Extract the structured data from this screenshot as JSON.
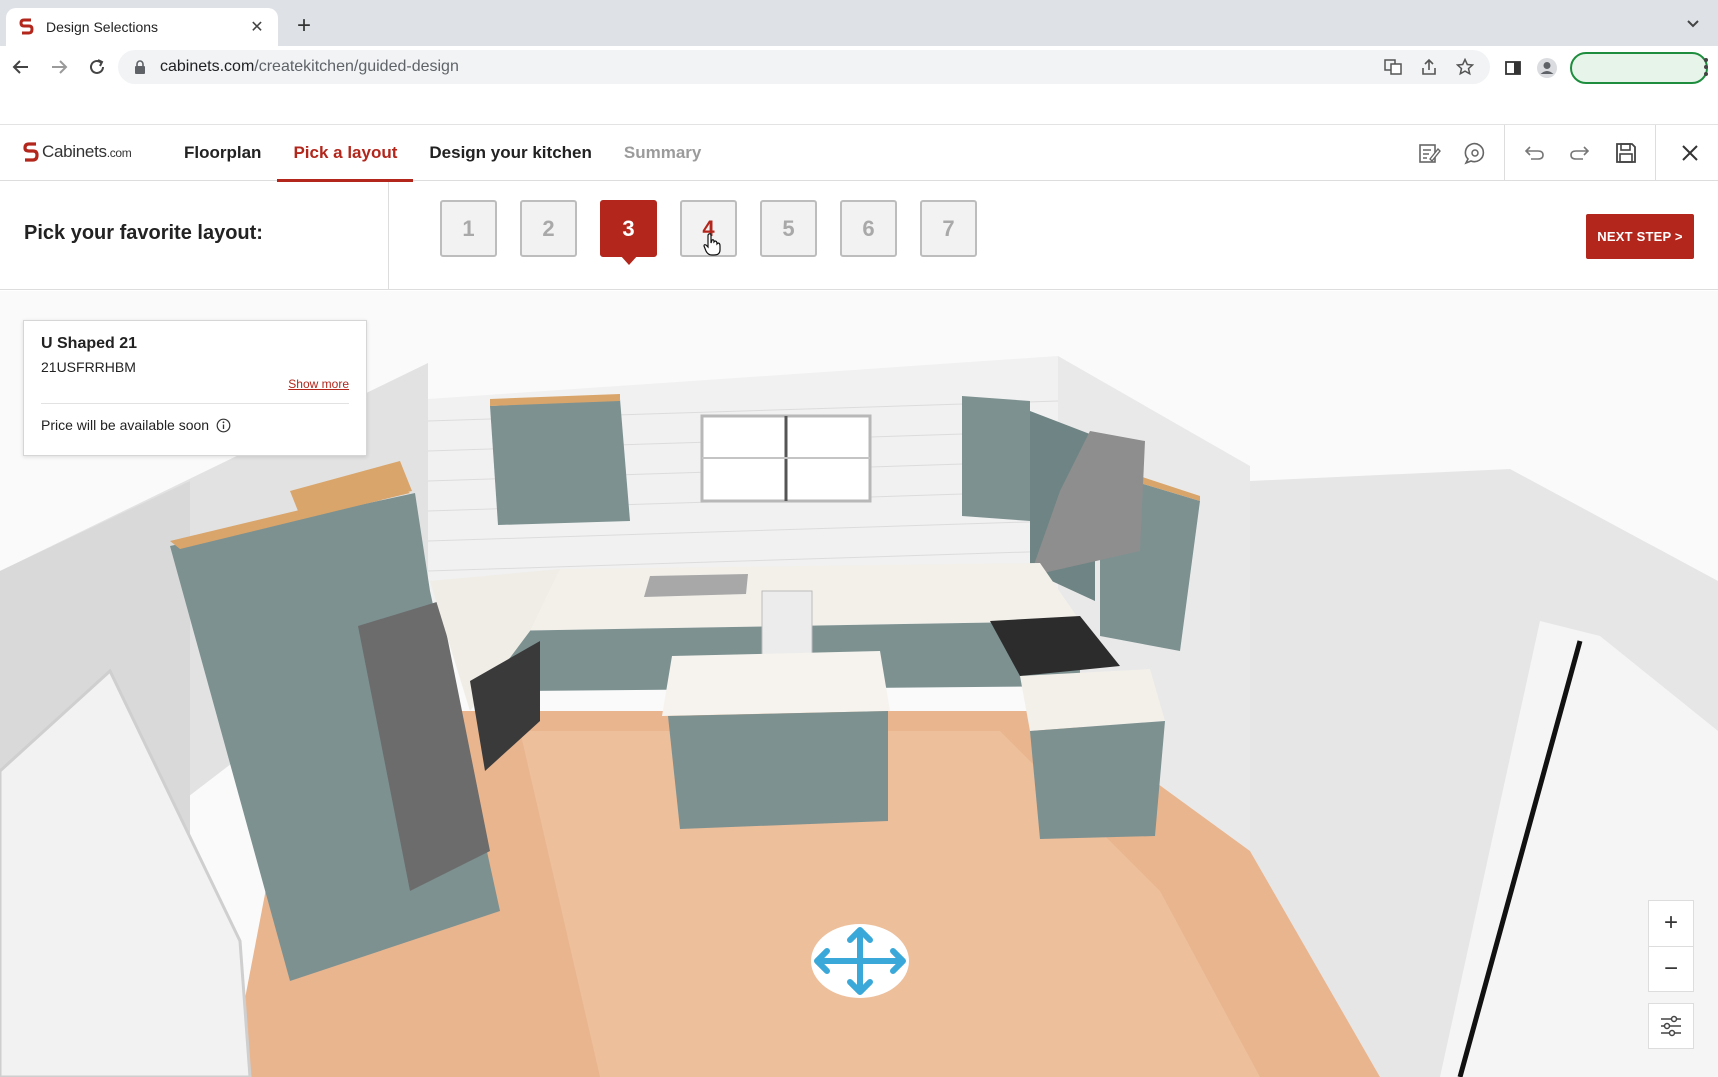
{
  "browser": {
    "tab_title": "Design Selections",
    "url_host": "cabinets.com",
    "url_path": "/createkitchen/guided-design"
  },
  "header": {
    "logo_text": "Cabinets",
    "logo_suffix": ".com",
    "nav": [
      {
        "label": "Floorplan",
        "state": "done"
      },
      {
        "label": "Pick a layout",
        "state": "active"
      },
      {
        "label": "Design your kitchen",
        "state": "done"
      },
      {
        "label": "Summary",
        "state": "disabled"
      }
    ],
    "tool_icons": [
      "notes-icon",
      "chat-icon",
      "undo-icon",
      "redo-icon",
      "save-icon",
      "close-icon"
    ]
  },
  "layout_picker": {
    "prompt": "Pick your favorite layout:",
    "options": [
      "1",
      "2",
      "3",
      "4",
      "5",
      "6",
      "7"
    ],
    "selected": "3",
    "hovered": "4",
    "next_label": "NEXT STEP >"
  },
  "layout_card": {
    "name": "U Shaped 21",
    "code": "21USFRRHBM",
    "show_more": "Show more",
    "price_text": "Price will be available soon"
  },
  "viewer": {
    "zoom_in": "+",
    "zoom_out": "−"
  },
  "colors": {
    "brand_red": "#b2261c",
    "cabinet_gray": "#7d9191",
    "floor_wood": "#e8b58f",
    "countertop": "#f3f0ea"
  }
}
